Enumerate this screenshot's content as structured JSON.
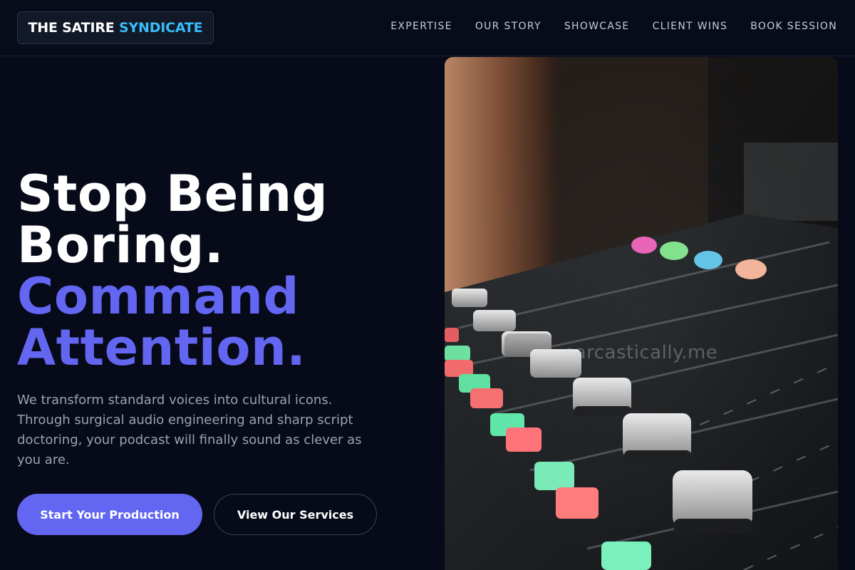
{
  "brand": {
    "part1": "THE SATIRE",
    "part2": "SYNDICATE"
  },
  "nav": [
    {
      "label": "EXPERTISE"
    },
    {
      "label": "OUR STORY"
    },
    {
      "label": "SHOWCASE"
    },
    {
      "label": "CLIENT WINS"
    },
    {
      "label": "BOOK SESSION"
    }
  ],
  "hero": {
    "line1": "Stop Being",
    "line2": "Boring.",
    "line3": "Command",
    "line4": "Attention.",
    "description": "We transform standard voices into cultural icons. Through surgical audio engineering and sharp script doctoring, your podcast will finally sound as clever as you are.",
    "primary_cta": "Start Your Production",
    "secondary_cta": "View Our Services",
    "image_watermark": "sarcastically.me"
  },
  "colors": {
    "background": "#070a18",
    "accent": "#6366f1",
    "brand_accent": "#38bdf8",
    "muted_text": "#9aa3b2"
  }
}
